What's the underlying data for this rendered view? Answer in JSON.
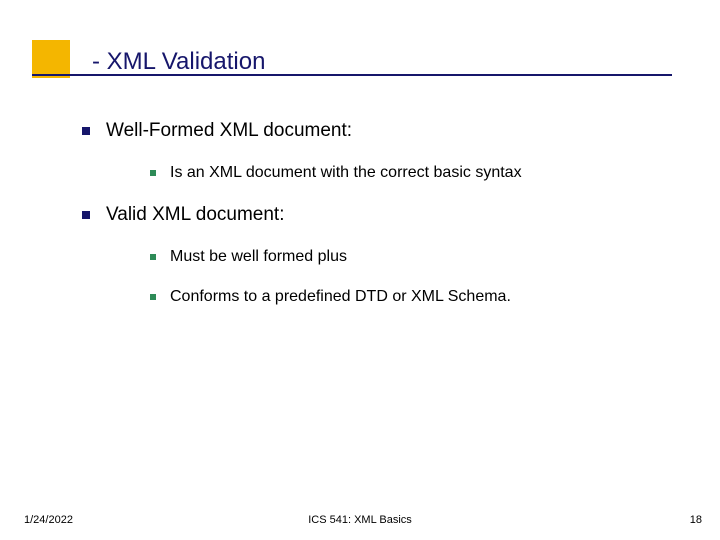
{
  "title": "- XML Validation",
  "bullets": [
    {
      "text": "Well-Formed XML document:",
      "children": [
        {
          "text": "Is an XML document with the correct basic syntax"
        }
      ]
    },
    {
      "text": "Valid XML document:",
      "children": [
        {
          "text": "Must be well formed plus"
        },
        {
          "text": "Conforms to a predefined  DTD or XML Schema."
        }
      ]
    }
  ],
  "footer": {
    "date": "1/24/2022",
    "center": "ICS 541: XML Basics",
    "page": "18"
  }
}
